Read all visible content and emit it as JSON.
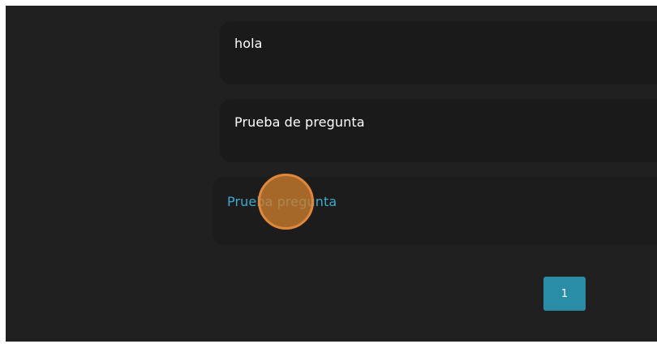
{
  "questions": [
    {
      "title": "hola"
    },
    {
      "title": "Prueba de pregunta"
    },
    {
      "title": "Prueba pregunta"
    }
  ],
  "pagination": {
    "current_page": "1"
  },
  "colors": {
    "background": "#202020",
    "card": "#1a1a1a",
    "link": "#3ea8cc",
    "accent": "#2a8da8",
    "cursor": "#e0873b"
  }
}
